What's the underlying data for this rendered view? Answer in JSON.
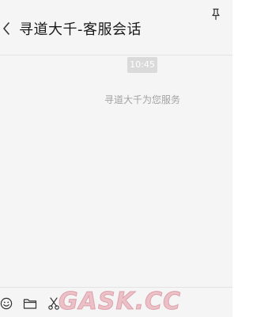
{
  "header": {
    "title": "寻道大千-客服会话",
    "back_icon": "chevron-left-icon",
    "pin_icon": "pin-icon"
  },
  "chat": {
    "timestamp": "10:45",
    "system_message": "寻道大千为您服务"
  },
  "toolbar": {
    "items": [
      {
        "icon": "emoji-icon"
      },
      {
        "icon": "folder-icon"
      },
      {
        "icon": "scissors-icon"
      }
    ]
  },
  "watermark": "GASK.CC",
  "colors": {
    "background": "#f5f5f5",
    "title_text": "#1a1a1a",
    "system_text": "#a3a3a3",
    "timestamp_bg": "#dadada",
    "divider": "#e3e3e3"
  }
}
